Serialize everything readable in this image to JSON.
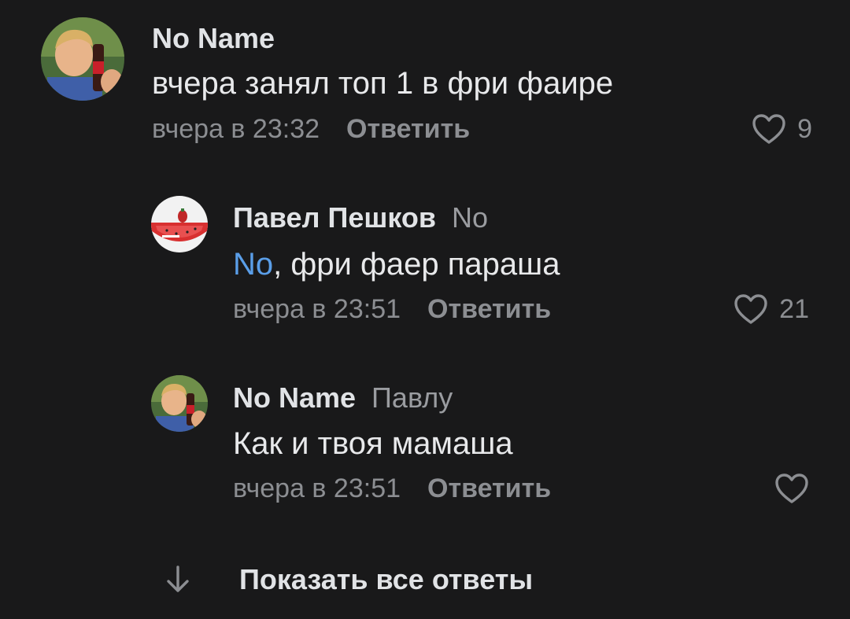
{
  "comments": [
    {
      "author": "No Name",
      "reply_to": "",
      "mention": "",
      "text": "вчера занял топ 1 в фри фаире",
      "time": "вчера в 23:32",
      "reply_label": "Ответить",
      "likes": "9"
    },
    {
      "author": "Павел Пешков",
      "reply_to": "No",
      "mention": "No",
      "text": ", фри фаер параша",
      "time": "вчера в 23:51",
      "reply_label": "Ответить",
      "likes": "21"
    },
    {
      "author": "No Name",
      "reply_to": "Павлу",
      "mention": "",
      "text": "Как и твоя мамаша",
      "time": "вчера в 23:51",
      "reply_label": "Ответить",
      "likes": ""
    }
  ],
  "show_all_replies": "Показать все ответы",
  "colors": {
    "background": "#19191a",
    "mention": "#5a9ee8",
    "secondary_text": "#8c8e92"
  }
}
